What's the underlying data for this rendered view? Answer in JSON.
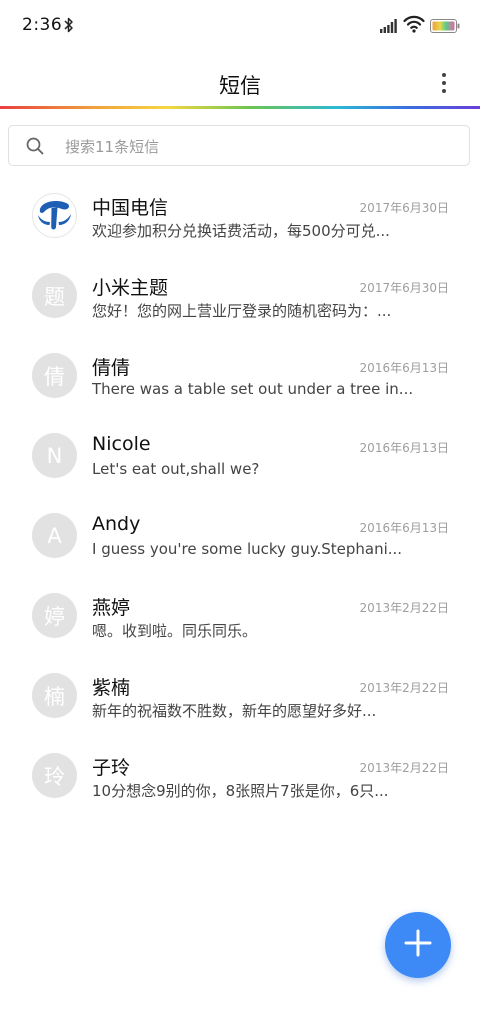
{
  "status_bar": {
    "time": "2:36",
    "icons": [
      "bluetooth-icon",
      "signal-icon",
      "wifi-icon",
      "battery-icon"
    ]
  },
  "header": {
    "title": "短信",
    "more_icon": "more-vertical-icon"
  },
  "search": {
    "placeholder": "搜索11条短信",
    "value": ""
  },
  "messages": [
    {
      "avatar": "",
      "avatar_type": "china-telecom-logo",
      "sender": "中国电信",
      "date": "2017年6月30日",
      "preview": "欢迎参加积分兑换话费活动，每500分可兑..."
    },
    {
      "avatar": "题",
      "sender": "小米主题",
      "date": "2017年6月30日",
      "preview": "您好！您的网上营业厅登录的随机密码为：..."
    },
    {
      "avatar": "倩",
      "sender": "倩倩",
      "date": "2016年6月13日",
      "preview": "There was a table set out under a tree in..."
    },
    {
      "avatar": "N",
      "sender": "Nicole",
      "date": "2016年6月13日",
      "preview": "Let's eat out,shall we?"
    },
    {
      "avatar": "A",
      "sender": "Andy",
      "date": "2016年6月13日",
      "preview": "I guess you're some lucky guy.Stephani..."
    },
    {
      "avatar": "婷",
      "sender": "燕婷",
      "date": "2013年2月22日",
      "preview": "嗯。收到啦。同乐同乐。"
    },
    {
      "avatar": "楠",
      "sender": "紫楠",
      "date": "2013年2月22日",
      "preview": "新年的祝福数不胜数，新年的愿望好多好..."
    },
    {
      "avatar": "玲",
      "sender": "子玲",
      "date": "2013年2月22日",
      "preview": "10分想念9别的你，8张照片7张是你，6只..."
    }
  ],
  "fab": {
    "icon": "plus-icon",
    "color": "#3d8af7"
  },
  "colors": {
    "accent": "#3d8af7",
    "avatar_bg": "#e2e2e2",
    "date_text": "#9e9e9e"
  }
}
